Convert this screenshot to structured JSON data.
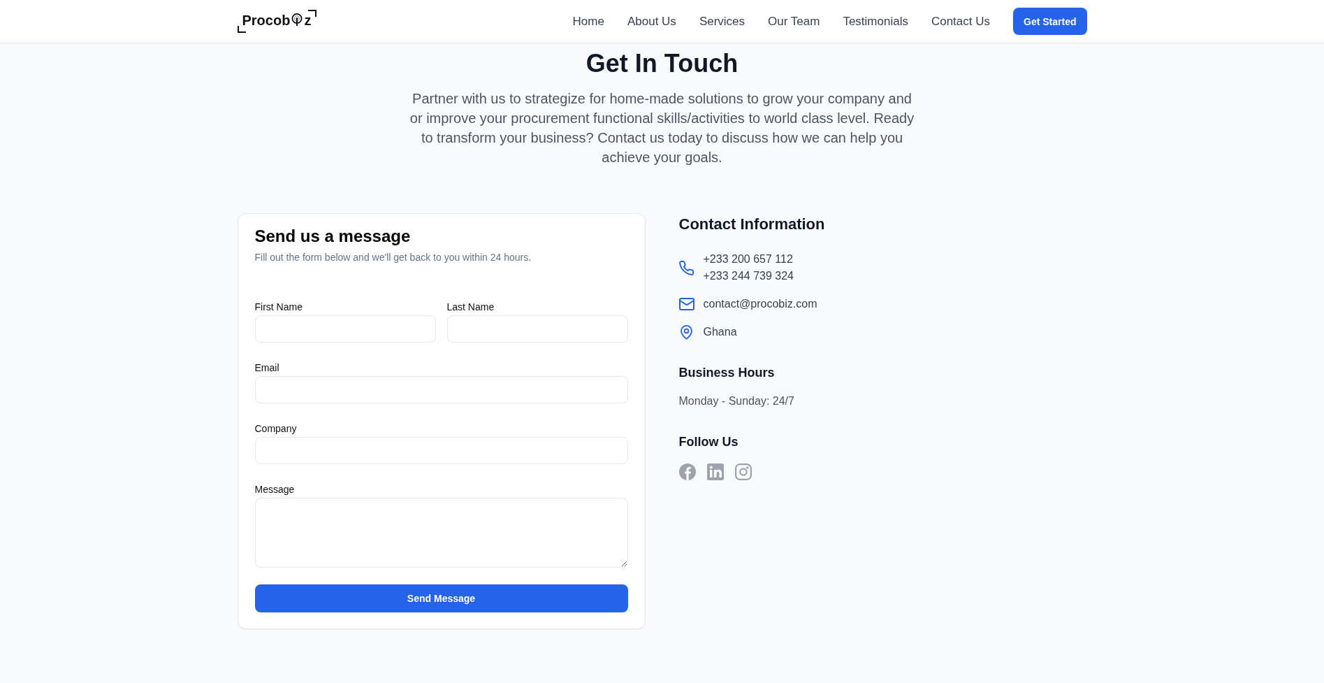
{
  "header": {
    "logo": {
      "text_start": "Procob",
      "text_end": "z"
    },
    "nav_links": [
      "Home",
      "About Us",
      "Services",
      "Our Team",
      "Testimonials",
      "Contact Us"
    ],
    "cta": "Get Started"
  },
  "hero": {
    "heading": "Get In Touch",
    "intro": "Partner with us to strategize for home-made solutions to grow your company and or improve your procurement functional skills/activities to world class level. Ready to transform your business? Contact us today to discuss how we can help you achieve your goals."
  },
  "form": {
    "title": "Send us a message",
    "subtitle": "Fill out the form below and we'll get back to you within 24 hours.",
    "rows": [
      {
        "fields": [
          {
            "label": "First Name",
            "kind": "text"
          },
          {
            "label": "Last Name",
            "kind": "text"
          }
        ]
      },
      {
        "fields": [
          {
            "label": "Email",
            "kind": "text"
          }
        ]
      },
      {
        "fields": [
          {
            "label": "Company",
            "kind": "text"
          }
        ]
      },
      {
        "fields": [
          {
            "label": "Message",
            "kind": "textarea"
          }
        ]
      }
    ],
    "submit": "Send Message"
  },
  "contact": {
    "title": "Contact Information",
    "items": [
      {
        "kind": "phone",
        "lines": [
          "+233 200 657 112",
          "+233 244 739 324"
        ]
      },
      {
        "kind": "email",
        "lines": [
          "contact@procobiz.com"
        ]
      },
      {
        "kind": "location",
        "lines": [
          "Ghana"
        ]
      }
    ],
    "hours": {
      "title": "Business Hours",
      "text": "Monday - Sunday: 24/7"
    },
    "follow": {
      "title": "Follow Us",
      "links": [
        {
          "kind": "facebook"
        },
        {
          "kind": "linkedin"
        },
        {
          "kind": "instagram"
        }
      ]
    }
  }
}
